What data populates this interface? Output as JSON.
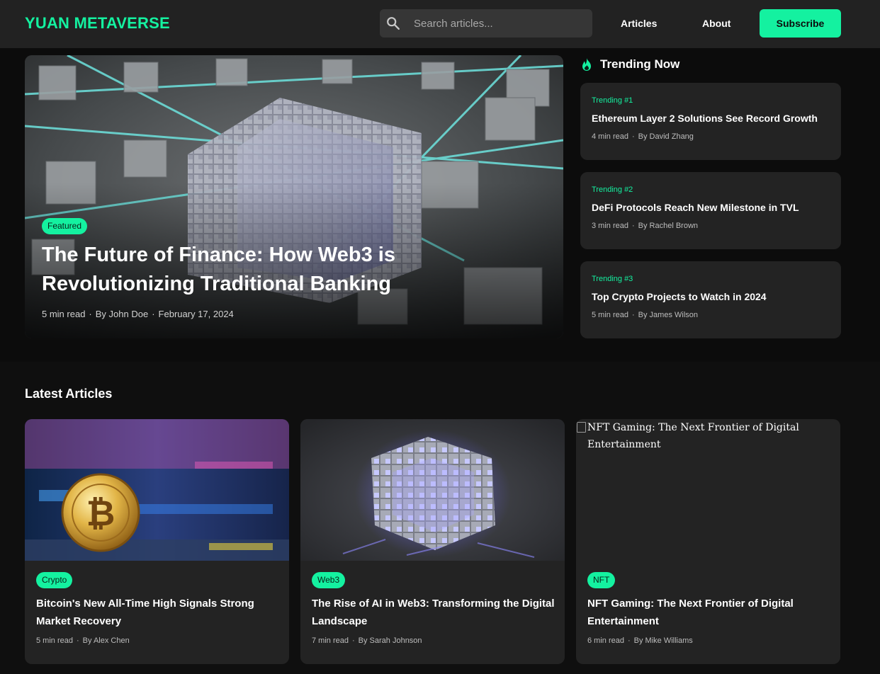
{
  "header": {
    "logo": "YUAN METAVERSE",
    "search_placeholder": "Search articles...",
    "nav": [
      "Articles",
      "About"
    ],
    "subscribe_label": "Subscribe"
  },
  "featured": {
    "tag": "Featured",
    "title": "The Future of Finance: How Web3 is Revolutionizing Traditional Banking",
    "meta": [
      "5 min read",
      "By John Doe",
      "February 17, 2024"
    ]
  },
  "trending": {
    "heading": "Trending Now",
    "items": [
      {
        "rank": "Trending #1",
        "title": "Ethereum Layer 2 Solutions See Record Growth",
        "read": "4 min read",
        "author": "By David Zhang"
      },
      {
        "rank": "Trending #2",
        "title": "DeFi Protocols Reach New Milestone in TVL",
        "read": "3 min read",
        "author": "By Rachel Brown"
      },
      {
        "rank": "Trending #3",
        "title": "Top Crypto Projects to Watch in 2024",
        "read": "5 min read",
        "author": "By James Wilson"
      }
    ]
  },
  "latest": {
    "heading": "Latest Articles",
    "items": [
      {
        "category": "Crypto",
        "title": "Bitcoin's New All-Time High Signals Strong Market Recovery",
        "read": "5 min read",
        "author": "By Alex Chen",
        "image_alt": ""
      },
      {
        "category": "Web3",
        "title": "The Rise of AI in Web3: Transforming the Digital Landscape",
        "read": "7 min read",
        "author": "By Sarah Johnson",
        "image_alt": ""
      },
      {
        "category": "NFT",
        "title": "NFT Gaming: The Next Frontier of Digital Entertainment",
        "read": "6 min read",
        "author": "By Mike Williams",
        "image_alt": "NFT Gaming: The Next Frontier of Digital Entertainment"
      }
    ]
  },
  "colors": {
    "accent": "#14f1a0",
    "header_bg": "#222222",
    "card_bg": "#232323",
    "page_bg": "#0f0f0f"
  },
  "icons": {
    "search": "search-icon",
    "trending": "flame-icon",
    "broken_image": "broken-image-icon"
  }
}
